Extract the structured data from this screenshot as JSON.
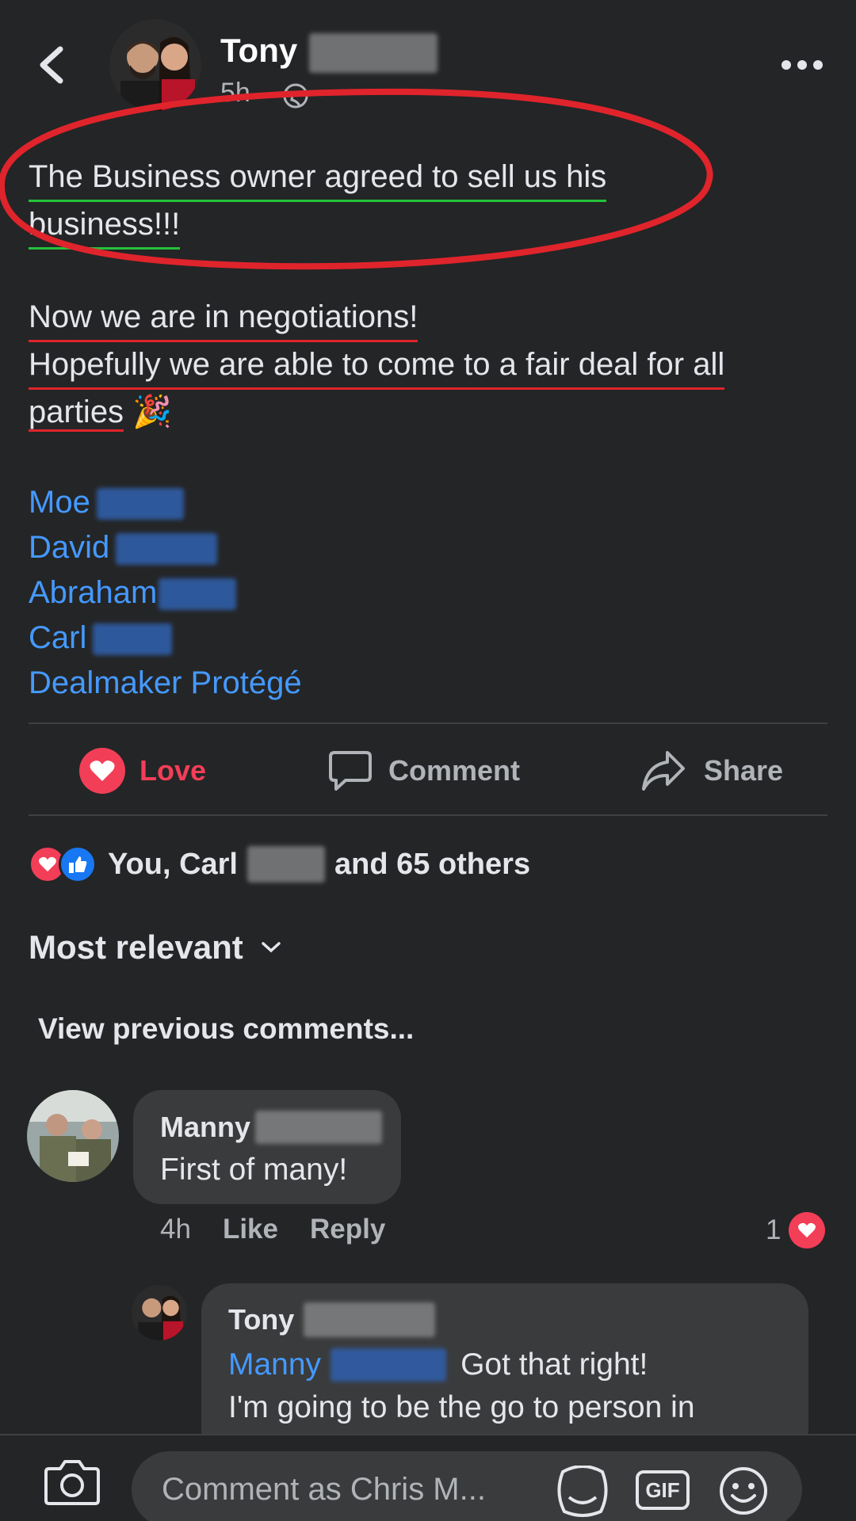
{
  "post": {
    "author": "Tony",
    "time": "5h",
    "lines": [
      "The Business owner agreed to sell us his",
      "business!!!",
      "Now we are in negotiations!",
      "Hopefully we are able to come to a fair deal for all",
      "parties"
    ],
    "emoji": "🎉",
    "tags": [
      "Moe",
      "David",
      "Abraham",
      "Carl",
      "Dealmaker Protégé"
    ]
  },
  "actions": {
    "love": "Love",
    "comment": "Comment",
    "share": "Share"
  },
  "reactions": {
    "prefix": "You, Carl",
    "suffix": "and 65 others"
  },
  "sort_label": "Most relevant",
  "view_previous": "View previous comments...",
  "comments": [
    {
      "name": "Manny",
      "text": "First of many!",
      "time": "4h",
      "like": "Like",
      "reply": "Reply",
      "reaction_count": "1"
    },
    {
      "name": "Tony",
      "mention": "Manny",
      "text": "Got that right!",
      "text2": "I'm going to be the go to person in"
    }
  ],
  "composer": {
    "placeholder": "Comment as Chris M...",
    "gif": "GIF"
  },
  "colors": {
    "background": "#242526",
    "bubble": "#3a3b3c",
    "link": "#4599ff",
    "love": "#f33e58",
    "like": "#1877f2",
    "circle": "#e0242c",
    "green_underline": "#25c23a"
  }
}
